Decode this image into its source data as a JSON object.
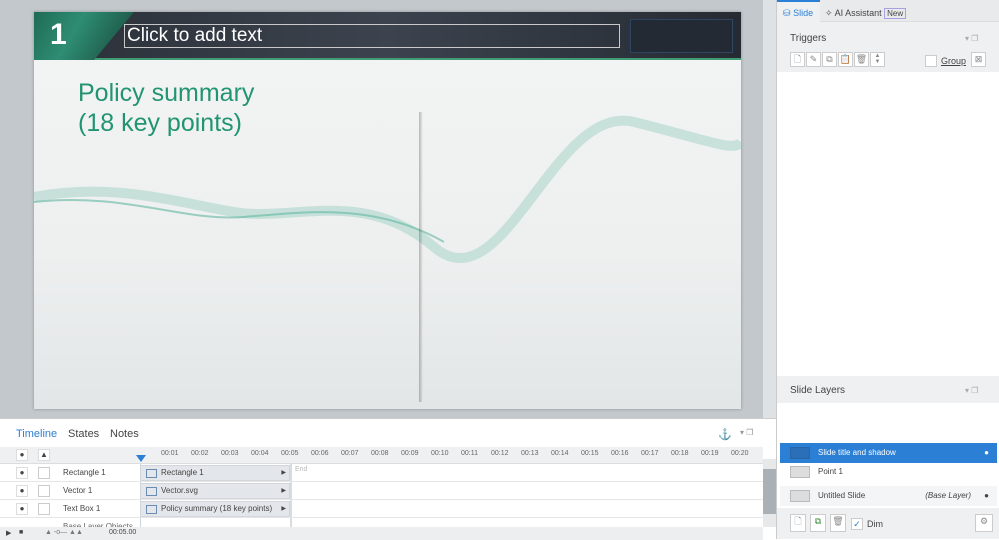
{
  "slide": {
    "number": "1",
    "title_placeholder": "Click to add text",
    "heading_line1": "Policy summary",
    "heading_line2": "(18 key points)"
  },
  "timeline": {
    "tabs": [
      "Timeline",
      "States",
      "Notes"
    ],
    "ticks": [
      "00:01",
      "00:02",
      "00:03",
      "00:04",
      "00:05",
      "00:06",
      "00:07",
      "00:08",
      "00:09",
      "00:10",
      "00:11",
      "00:12",
      "00:13",
      "00:14",
      "00:15",
      "00:16",
      "00:17",
      "00:18",
      "00:19",
      "00:20"
    ],
    "end_label": "End",
    "rows": [
      {
        "name": "Rectangle 1",
        "bar": "Rectangle 1"
      },
      {
        "name": "Vector 1",
        "bar": "Vector.svg"
      },
      {
        "name": "Text Box 1",
        "bar": "Policy summary (18 key points)"
      }
    ],
    "partial_row": "Base Layer Objects",
    "duration": "00:05.00"
  },
  "panel": {
    "tab_slide": "Slide",
    "tab_ai": "AI Assistant",
    "badge_new": "New",
    "triggers_title": "Triggers",
    "group_label": "Group",
    "layers_title": "Slide Layers",
    "layers": [
      {
        "name": "Slide title and shadow",
        "note": ""
      },
      {
        "name": "Point 1",
        "note": ""
      },
      {
        "name": "Untitled Slide",
        "note": "(Base Layer)"
      }
    ],
    "dim_label": "Dim"
  },
  "colors": {
    "accent": "#2b7fd4",
    "heading": "#239471"
  }
}
